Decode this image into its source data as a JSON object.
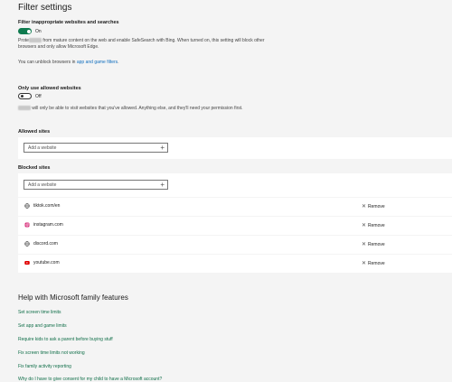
{
  "page_title": "Filter settings",
  "filter": {
    "title": "Filter inappropriate websites and searches",
    "toggle_state": "On",
    "desc_line1": "from mature content on the web and enable SafeSearch with Bing. When turned on, this setting will block other",
    "desc_prefix": "Prote",
    "desc_line2": "browsers and only allow Microsoft Edge.",
    "unblock_text": "You can unblock browsers in",
    "unblock_link": "app and game filters",
    "unblock_end": "."
  },
  "allowed_only": {
    "title": "Only use allowed websites",
    "toggle_state": "Off",
    "desc": "will only be able to visit websites that you've allowed. Anything else, and they'll need your permission first."
  },
  "allowed_sites": {
    "label": "Allowed sites",
    "placeholder": "Add a website"
  },
  "blocked_sites": {
    "label": "Blocked sites",
    "placeholder": "Add a website",
    "remove_label": "Remove",
    "items": [
      {
        "name": "tiktok.com/en",
        "icon": "globe-icon"
      },
      {
        "name": "instagram.com",
        "icon": "instagram-icon"
      },
      {
        "name": "discord.com",
        "icon": "globe-icon"
      },
      {
        "name": "youtube.com",
        "icon": "youtube-icon"
      }
    ]
  },
  "help": {
    "title": "Help with Microsoft family features",
    "links": [
      "Set screen time limits",
      "Set app and game limits",
      "Require kids to ask a parent before buying stuff",
      "Fix screen time limits not working",
      "Fix family activity reporting",
      "Why do I have to give consent for my child to have a Microsoft account?"
    ]
  },
  "colors": {
    "accent_green": "#0f7b4f",
    "link_blue": "#106ebe",
    "instagram": "#d62976",
    "youtube": "#e00000"
  }
}
